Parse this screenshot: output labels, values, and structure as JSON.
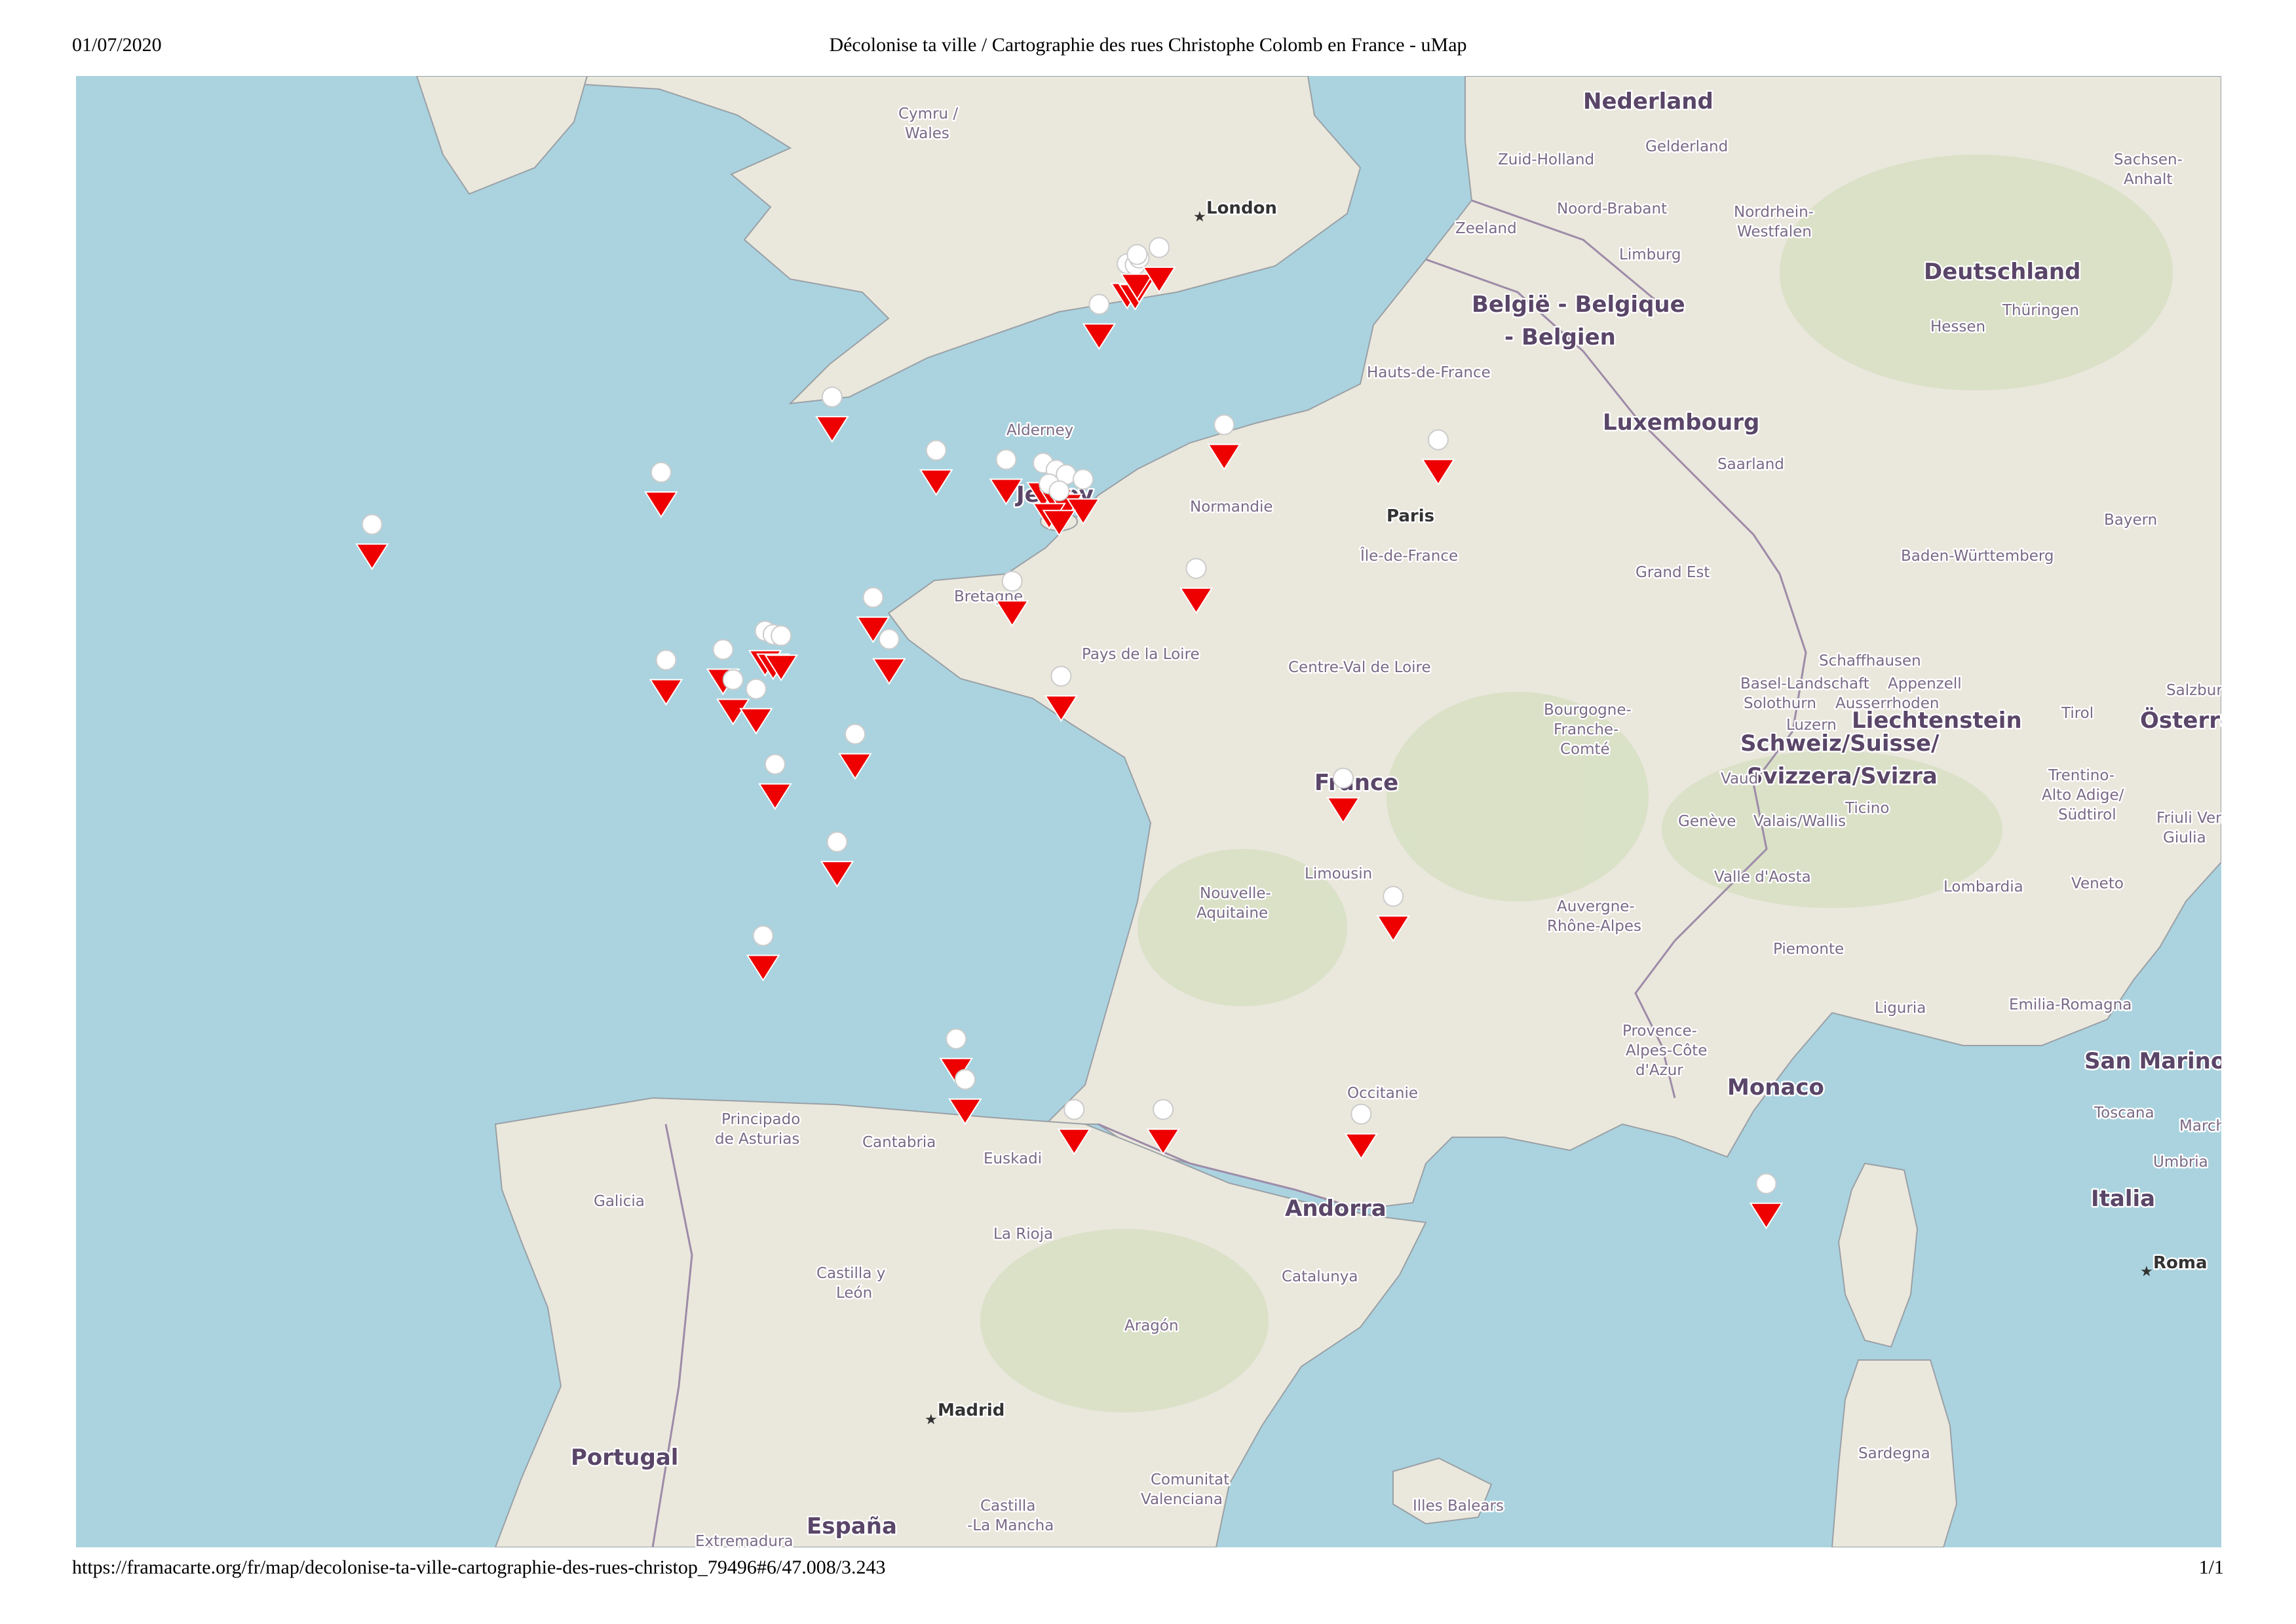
{
  "print": {
    "date": "01/07/2020",
    "title": "Décolonise ta ville / Cartographie des rues Christophe Colomb en France - uMap",
    "url": "https://framacarte.org/fr/map/decolonise-ta-ville-cartographie-des-rues-christop_79496#6/47.008/3.243",
    "page": "1/1"
  },
  "colors": {
    "sea": "#aad3df",
    "land": "#eae7dc",
    "land_green": "#dfe5cf",
    "border": "#8a7a99",
    "marker_red": "#ee0000",
    "marker_white": "#ffffff"
  },
  "labels": {
    "countries": [
      "Nederland",
      "België - Belgique",
      "- Belgien",
      "Deutschland",
      "Luxembourg",
      "France",
      "Schweiz/Suisse/",
      "Svizzera/Svizra",
      "Liechtenstein",
      "Österreich",
      "Monaco",
      "San Marino",
      "Italia",
      "Andorra",
      "Portugal",
      "España",
      "Jersey"
    ],
    "regions": [
      "Cymru /",
      "Wales",
      "Alderney",
      "Normandie",
      "Bretagne",
      "Pays de la Loire",
      "Centre-Val de Loire",
      "Île-de-France",
      "Hauts-de-France",
      "Grand Est",
      "Bourgogne-",
      "Franche-",
      "Comté",
      "Nouvelle-",
      "Aquitaine",
      "Limousin",
      "Auvergne-",
      "Rhône-Alpes",
      "Provence-",
      "Alpes-Côte",
      "d'Azur",
      "Occitanie",
      "Zuid-Holland",
      "Gelderland",
      "Noord-Brabant",
      "Limburg",
      "Zeeland",
      "Nordrhein-",
      "Westfalen",
      "Hessen",
      "Thüringen",
      "Sachsen-",
      "Anhalt",
      "Saarland",
      "Bayern",
      "Baden-Württemberg",
      "Basel-Landschaft",
      "Appenzell",
      "Solothurn",
      "Ausserrhoden",
      "Luzern",
      "Schaffhausen",
      "Vaud",
      "Genève",
      "Ticino",
      "Valais/Wallis",
      "Tirol",
      "Salzburg",
      "Trentino-",
      "Alto Adige/",
      "Südtirol",
      "Friuli Vene",
      "Giulia",
      "Veneto",
      "Lombardia",
      "Valle d'Aosta",
      "Piemonte",
      "Liguria",
      "Emilia-Romagna",
      "Toscana",
      "Marche",
      "Umbria",
      "Principado",
      "de Asturias",
      "Cantabria",
      "Euskadi",
      "Galicia",
      "La Rioja",
      "Castilla y",
      "León",
      "Aragón",
      "Catalunya",
      "Comunitat",
      "Valenciana",
      "Castilla",
      "-La Mancha",
      "Extremadura",
      "Illes Balears",
      "Sardegna"
    ],
    "cities": [
      "London",
      "Madrid",
      "Roma",
      "Paris"
    ]
  },
  "markers": [
    {
      "lat": 50.64,
      "lon": 3.06,
      "type": "red"
    },
    {
      "lat": 50.63,
      "lon": 3.14,
      "type": "red"
    },
    {
      "lat": 50.69,
      "lon": 3.18,
      "type": "red"
    },
    {
      "lat": 50.72,
      "lon": 3.16,
      "type": "red"
    },
    {
      "lat": 50.78,
      "lon": 3.38,
      "type": "red"
    },
    {
      "lat": 50.29,
      "lon": 2.78,
      "type": "red"
    },
    {
      "lat": 49.49,
      "lon": 0.11,
      "type": "red"
    },
    {
      "lat": 49.25,
      "lon": 4.03,
      "type": "red"
    },
    {
      "lat": 49.12,
      "lon": 6.17,
      "type": "red"
    },
    {
      "lat": 49.03,
      "lon": 1.15,
      "type": "red"
    },
    {
      "lat": 48.95,
      "lon": 1.85,
      "type": "red"
    },
    {
      "lat": 48.92,
      "lon": 2.22,
      "type": "red"
    },
    {
      "lat": 48.86,
      "lon": 2.35,
      "type": "red"
    },
    {
      "lat": 48.82,
      "lon": 2.45,
      "type": "red"
    },
    {
      "lat": 48.78,
      "lon": 2.62,
      "type": "red"
    },
    {
      "lat": 48.74,
      "lon": 2.28,
      "type": "red"
    },
    {
      "lat": 48.68,
      "lon": 2.38,
      "type": "red"
    },
    {
      "lat": 48.84,
      "lon": -1.6,
      "type": "red"
    },
    {
      "lat": 48.39,
      "lon": -4.49,
      "type": "red"
    },
    {
      "lat": 48.01,
      "lon": 3.75,
      "type": "red"
    },
    {
      "lat": 47.9,
      "lon": 1.91,
      "type": "red"
    },
    {
      "lat": 47.76,
      "lon": 0.52,
      "type": "red"
    },
    {
      "lat": 47.47,
      "lon": -0.56,
      "type": "red"
    },
    {
      "lat": 47.44,
      "lon": -0.48,
      "type": "red"
    },
    {
      "lat": 47.43,
      "lon": -0.4,
      "type": "red"
    },
    {
      "lat": 47.4,
      "lon": 0.68,
      "type": "red"
    },
    {
      "lat": 47.31,
      "lon": -0.98,
      "type": "red"
    },
    {
      "lat": 47.22,
      "lon": -1.55,
      "type": "red"
    },
    {
      "lat": 47.08,
      "lon": 2.4,
      "type": "red"
    },
    {
      "lat": 47.05,
      "lon": -0.88,
      "type": "red"
    },
    {
      "lat": 46.97,
      "lon": -0.65,
      "type": "red"
    },
    {
      "lat": 46.58,
      "lon": 0.34,
      "type": "red"
    },
    {
      "lat": 46.32,
      "lon": -0.46,
      "type": "red"
    },
    {
      "lat": 46.2,
      "lon": 5.22,
      "type": "red"
    },
    {
      "lat": 45.65,
      "lon": 0.16,
      "type": "red"
    },
    {
      "lat": 45.18,
      "lon": 5.72,
      "type": "red"
    },
    {
      "lat": 44.84,
      "lon": -0.58,
      "type": "red"
    },
    {
      "lat": 43.95,
      "lon": 1.35,
      "type": "red"
    },
    {
      "lat": 43.6,
      "lon": 1.44,
      "type": "red"
    },
    {
      "lat": 43.34,
      "lon": 2.53,
      "type": "red"
    },
    {
      "lat": 43.34,
      "lon": 3.42,
      "type": "red"
    },
    {
      "lat": 43.3,
      "lon": 5.4,
      "type": "red"
    },
    {
      "lat": 42.7,
      "lon": 9.45,
      "type": "red"
    }
  ]
}
